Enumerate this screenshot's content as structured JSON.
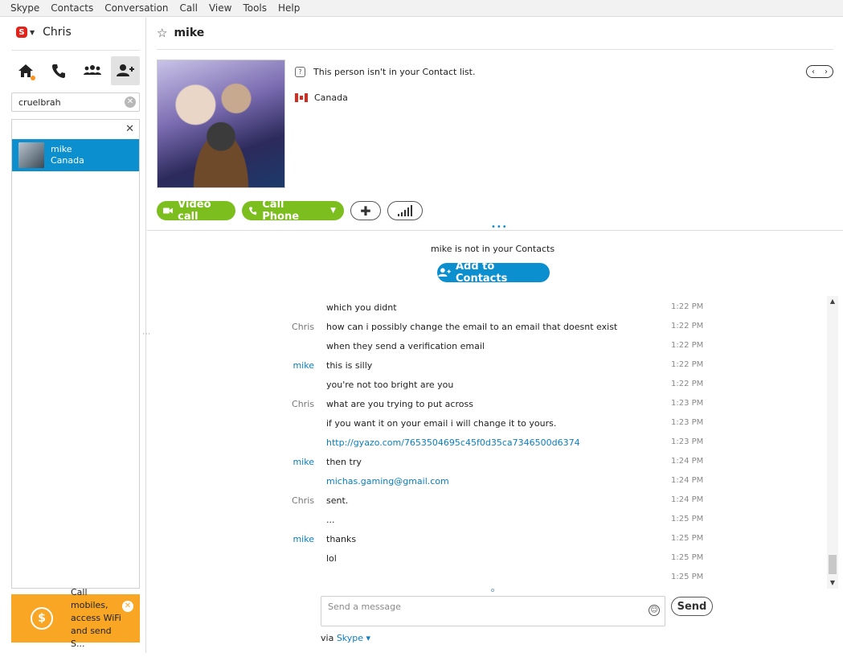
{
  "menu": [
    "Skype",
    "Contacts",
    "Conversation",
    "Call",
    "View",
    "Tools",
    "Help"
  ],
  "colors": {
    "accent": "#0c8fcf",
    "call_green": "#7cbe1e",
    "promo": "#f9a624",
    "skype_red": "#e2231a"
  },
  "profile": {
    "name": "Chris"
  },
  "nav": {
    "icons": [
      "home-icon",
      "call-icon",
      "contacts-group-icon",
      "add-contact-icon"
    ]
  },
  "search": {
    "value": "cruelbrah"
  },
  "results": [
    {
      "name": "mike",
      "location": "Canada"
    }
  ],
  "promo": {
    "text": "Call mobiles, access WiFi and send S..."
  },
  "conversation": {
    "title": "mike",
    "info_not_in_list": "This person isn't in your Contact list.",
    "country": "Canada",
    "video_call_label": "Video call",
    "call_phone_label": "Call Phone",
    "not_in_contacts": "mike is not in your Contacts",
    "add_contacts_label": "Add to Contacts"
  },
  "messages": [
    {
      "sender": "",
      "text": "which you didnt",
      "time": "1:22 PM"
    },
    {
      "sender": "Chris",
      "text": "how can i possibly change the email to an email that doesnt exist",
      "time": "1:22 PM"
    },
    {
      "sender": "",
      "text": "when they send a verification email",
      "time": "1:22 PM"
    },
    {
      "sender": "mike",
      "text": "this is silly",
      "time": "1:22 PM"
    },
    {
      "sender": "",
      "text": "you're not too bright are you",
      "time": "1:22 PM"
    },
    {
      "sender": "Chris",
      "text": "what are you trying to put across",
      "time": "1:23 PM"
    },
    {
      "sender": "",
      "text": "if you want it on your email i will change it to yours.",
      "time": "1:23 PM"
    },
    {
      "sender": "",
      "text": "http://gyazo.com/7653504695c45f0d35ca7346500d6374",
      "time": "1:23 PM",
      "link": true
    },
    {
      "sender": "mike",
      "text": "then try",
      "time": "1:24 PM"
    },
    {
      "sender": "",
      "text": "michas.gaming@gmail.com",
      "time": "1:24 PM",
      "link": true
    },
    {
      "sender": "Chris",
      "text": "sent.",
      "time": "1:24 PM"
    },
    {
      "sender": "",
      "text": "...",
      "time": "1:25 PM"
    },
    {
      "sender": "mike",
      "text": "thanks",
      "time": "1:25 PM"
    },
    {
      "sender": "",
      "text": "lol",
      "time": "1:25 PM"
    },
    {
      "sender": "",
      "text": "",
      "time": "1:25 PM"
    }
  ],
  "composer": {
    "placeholder": "Send a message",
    "send_label": "Send",
    "via_prefix": "via",
    "via_service": "Skype"
  }
}
